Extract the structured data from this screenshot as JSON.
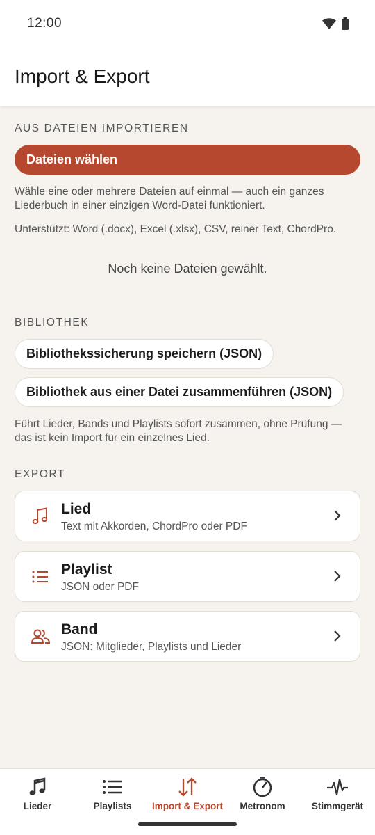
{
  "status_bar": {
    "time": "12:00"
  },
  "app_bar": {
    "title": "Import & Export"
  },
  "import_section": {
    "heading": "AUS DATEIEN IMPORTIEREN",
    "choose_files_label": "Dateien wählen",
    "description": "Wähle eine oder mehrere Dateien auf einmal — auch ein ganzes Liederbuch in einer einzigen Word-Datei funktioniert.",
    "supported": "Unterstützt: Word (.docx), Excel (.xlsx), CSV, reiner Text, ChordPro.",
    "empty_state": "Noch keine Dateien gewählt."
  },
  "library_section": {
    "heading": "BIBLIOTHEK",
    "save_backup_label": "Bibliothekssicherung speichern (JSON)",
    "merge_label": "Bibliothek aus einer Datei zusammenführen (JSON)",
    "note": "Führt Lieder, Bands und Playlists sofort zusammen, ohne Prüfung — das ist kein Import für ein einzelnes Lied."
  },
  "export_section": {
    "heading": "EXPORT",
    "items": [
      {
        "title": "Lied",
        "subtitle": "Text mit Akkorden, ChordPro oder PDF",
        "icon": "music-note-icon"
      },
      {
        "title": "Playlist",
        "subtitle": "JSON oder PDF",
        "icon": "list-icon"
      },
      {
        "title": "Band",
        "subtitle": "JSON: Mitglieder, Playlists und Lieder",
        "icon": "people-icon"
      }
    ]
  },
  "bottom_nav": {
    "items": [
      {
        "label": "Lieder",
        "icon": "music-note-icon",
        "active": false
      },
      {
        "label": "Playlists",
        "icon": "list-icon",
        "active": false
      },
      {
        "label": "Import & Export",
        "icon": "import-export-icon",
        "active": true
      },
      {
        "label": "Metronom",
        "icon": "metronome-icon",
        "active": false
      },
      {
        "label": "Stimmgerät",
        "icon": "tuner-icon",
        "active": false
      }
    ]
  },
  "colors": {
    "accent": "#b5482e",
    "background": "#f6f3ee",
    "surface": "#ffffff"
  }
}
